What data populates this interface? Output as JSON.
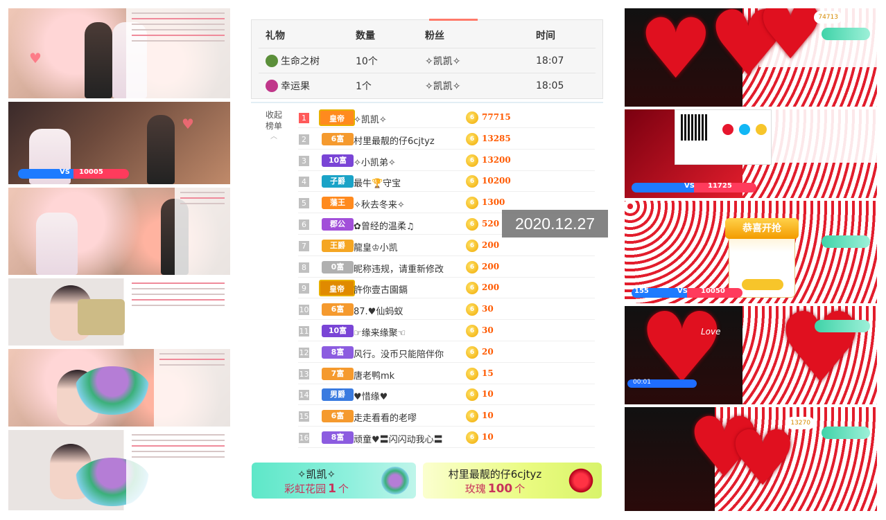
{
  "gift_table": {
    "headers": [
      "礼物",
      "数量",
      "粉丝",
      "时间"
    ],
    "rows": [
      {
        "gift": "生命之树",
        "qty": "10个",
        "fan": "✧凯凯✧",
        "time": "18:07",
        "icon_color": "#5b8f3a"
      },
      {
        "gift": "幸运果",
        "qty": "1个",
        "fan": "✧凯凯✧",
        "time": "18:05",
        "icon_color": "#c0378a"
      }
    ]
  },
  "ranking": {
    "collapse_label_line1": "收起",
    "collapse_label_line2": "榜单",
    "entries": [
      {
        "rank": "1",
        "badge": "皇帝",
        "badge_color": "#ff8a1e",
        "name": "✧凯凯✧",
        "value": "77715"
      },
      {
        "rank": "2",
        "badge": "6富",
        "badge_color": "#f59a2e",
        "name": "村里最靓的仔6cjtyz",
        "value": "13285"
      },
      {
        "rank": "3",
        "badge": "10富",
        "badge_color": "#7a45d6",
        "name": "✧小凯弟✧",
        "value": "13200"
      },
      {
        "rank": "4",
        "badge": "子爵",
        "badge_color": "#1aa3c7",
        "name": "最牛🏆守宝",
        "value": "10200"
      },
      {
        "rank": "5",
        "badge": "藩王",
        "badge_color": "#ff8a1e",
        "name": "✧秋去冬来✧",
        "value": "1300"
      },
      {
        "rank": "6",
        "badge": "郡公",
        "badge_color": "#a24fd9",
        "name": "✿曾经的温柔♫",
        "value": "520"
      },
      {
        "rank": "7",
        "badge": "王爵",
        "badge_color": "#f5a623",
        "name": "龍皇♔小凯",
        "value": "200"
      },
      {
        "rank": "8",
        "badge": "0富",
        "badge_color": "#b0b0b0",
        "name": "昵称违规，请重新修改",
        "value": "200"
      },
      {
        "rank": "9",
        "badge": "皇帝",
        "badge_color": "#e08a00",
        "name": "許你壹古園鎘",
        "value": "200"
      },
      {
        "rank": "10",
        "badge": "6富",
        "badge_color": "#f59a2e",
        "name": "87.♥仙蚂蚁",
        "value": "30"
      },
      {
        "rank": "11",
        "badge": "10富",
        "badge_color": "#7a45d6",
        "name": "☞缘来缘聚☜",
        "value": "30"
      },
      {
        "rank": "12",
        "badge": "8富",
        "badge_color": "#8c5ce0",
        "name": "风行。没币只能陪伴你",
        "value": "20"
      },
      {
        "rank": "13",
        "badge": "7富",
        "badge_color": "#f59a2e",
        "name": "唐老鸭mk",
        "value": "15"
      },
      {
        "rank": "14",
        "badge": "男爵",
        "badge_color": "#3a7be0",
        "name": "♥惜缘♥",
        "value": "10"
      },
      {
        "rank": "15",
        "badge": "6富",
        "badge_color": "#f59a2e",
        "name": "走走看看的老嘐",
        "value": "10"
      },
      {
        "rank": "16",
        "badge": "8富",
        "badge_color": "#8c5ce0",
        "name": "顽童♥〓闪闪动我心〓",
        "value": "10"
      }
    ],
    "coin_symbol": "6"
  },
  "date_overlay": "2020.12.27",
  "banners": [
    {
      "name": "✧凯凯✧",
      "gift": "彩虹花园",
      "count": "1",
      "unit": "个"
    },
    {
      "name": "村里最靓的仔6cjtyz",
      "gift": "玫瑰",
      "count": "100",
      "unit": "个"
    }
  ],
  "left_panels": {
    "vs_score_left": "10005",
    "vs_label": "VS"
  },
  "right_panels": {
    "vs_label": "VS",
    "score_a": "11725",
    "score_b": "10050",
    "score_c": "155",
    "top_values": [
      "74713",
      "10050",
      "13270"
    ],
    "love_text": "Love",
    "time_readout": "00:01",
    "popup_title": "恭喜开抢"
  },
  "colors": {
    "accent_red": "#ff5a5a",
    "value_orange": "#ff5a00",
    "coin_gold": "#f0a800"
  }
}
